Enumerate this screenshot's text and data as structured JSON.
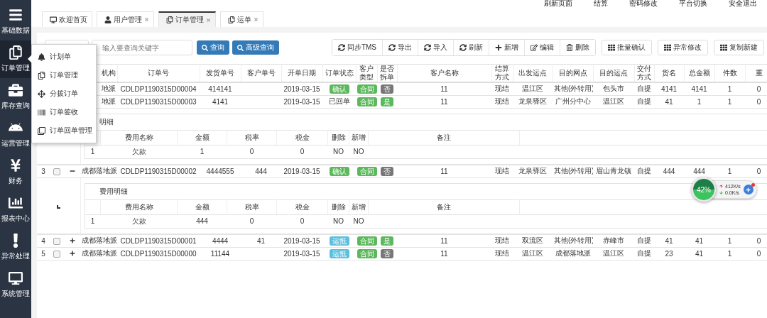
{
  "header_links": [
    "刷新页面",
    "结算",
    "密码修改",
    "平台切换",
    "安全退出"
  ],
  "sidebar": [
    {
      "label": "基础数据",
      "selected": false
    },
    {
      "label": "订单管理",
      "selected": true
    },
    {
      "label": "库存查询",
      "selected": false
    },
    {
      "label": "运营管理",
      "selected": false
    },
    {
      "label": "财务",
      "selected": false
    },
    {
      "label": "报表中心",
      "selected": false
    },
    {
      "label": "异常处理",
      "selected": false
    },
    {
      "label": "系统管理",
      "selected": false
    }
  ],
  "submenu": [
    {
      "label": "计划单"
    },
    {
      "label": "订单管理"
    },
    {
      "label": "分拨订单"
    },
    {
      "label": "订单签收"
    },
    {
      "label": "订单回单管理"
    }
  ],
  "tabs": [
    {
      "label": "欢迎首页",
      "closable": false,
      "selected": false
    },
    {
      "label": "用户管理",
      "closable": true,
      "selected": false
    },
    {
      "label": "订单管理",
      "closable": true,
      "selected": true
    },
    {
      "label": "运单",
      "closable": true,
      "selected": false
    }
  ],
  "toolbar": {
    "search": {
      "placeholder": "输入要查询关键字"
    },
    "search_buttons": [
      "查询",
      "高级查询"
    ],
    "actions": [
      "同步TMS",
      "导出",
      "导入",
      "刷新",
      "新增",
      "编辑",
      "删除"
    ],
    "extra_actions": [
      "批量确认",
      "异常修改",
      "复制新建"
    ]
  },
  "table": {
    "columns": [
      "机构",
      "订单号",
      "发货单号",
      "客户单号",
      "开单日期",
      "订单状态",
      "客户类型",
      "是否拆单",
      "客户名称",
      "结算方式",
      "出发运点",
      "目的网点",
      "目的运点",
      "交付方式",
      "货名",
      "总金额",
      "件数",
      "重"
    ],
    "rows": [
      {
        "org": "地派",
        "order_no": "CDLDP1190315D00004",
        "ship_no": "414141",
        "date": "2019-03-15",
        "status": {
          "text": "确认",
          "kind": "confirmed"
        },
        "type": "合同",
        "split": {
          "text": "否",
          "on": false
        },
        "customer": "11",
        "settle": "现结",
        "from": "温江区",
        "dest_point": "其他(外转用)",
        "dest": "包头市",
        "delivery": "自提",
        "goods": "4141",
        "total": "4141",
        "pieces": "1",
        "weight": "0"
      },
      {
        "org": "地派",
        "order_no": "CDLDP1190315D00003",
        "ship_no": "4141",
        "date": "2019-03-15",
        "status": {
          "text": "已回单",
          "kind": "plain"
        },
        "type": "合同",
        "split": {
          "text": "是",
          "on": true
        },
        "customer": "11",
        "settle": "现结",
        "from": "龙泉驿区",
        "dest_point": "广州分中心",
        "dest": "温江区",
        "delivery": "自提",
        "goods": "41",
        "total": "1",
        "pieces": "1",
        "weight": "0",
        "detail": {
          "title": "明细",
          "marker": false,
          "columns": [
            "费用名称",
            "金额",
            "税率",
            "税金",
            "删除",
            "新增",
            "备注"
          ],
          "rows": [
            {
              "index": "1",
              "cells": [
                "欠款",
                "1",
                "0",
                "0",
                "NO",
                "NO"
              ]
            }
          ]
        }
      },
      {
        "number": "3",
        "checked": false,
        "expanded": true,
        "org": "成都落地派",
        "order_no": "CDLDP1190315D00002",
        "ship_no": "4444555",
        "customer_no": "444",
        "date": "2019-03-15",
        "status": {
          "text": "确认",
          "kind": "confirmed"
        },
        "type": "合同",
        "split": {
          "text": "否",
          "on": false
        },
        "customer": "11",
        "settle": "现结",
        "from": "龙泉驿区",
        "dest_point": "其他(外转用)",
        "dest": "眉山青龙镇",
        "delivery": "自提",
        "goods": "444",
        "total": "444",
        "pieces": "1",
        "weight": "0",
        "detail": {
          "title": "费用明细",
          "marker": true,
          "columns": [
            "费用名称",
            "金额",
            "税率",
            "税金",
            "删除",
            "新增",
            "备注"
          ],
          "rows": [
            {
              "index": "1",
              "cells": [
                "欠款",
                "444",
                "0",
                "0",
                "NO",
                "NO"
              ]
            }
          ]
        }
      },
      {
        "number": "4",
        "checked": false,
        "expanded": false,
        "org": "成都落地派",
        "order_no": "CDLDP1190315D00001",
        "ship_no": "4444",
        "customer_no": "41",
        "date": "2019-03-15",
        "status": {
          "text": "运抵",
          "kind": "arrived"
        },
        "type": "合同",
        "split": {
          "text": "是",
          "on": true
        },
        "customer": "11",
        "settle": "现结",
        "from": "双流区",
        "dest_point": "其他(外转用)",
        "dest": "赤峰市",
        "delivery": "自提",
        "goods": "41",
        "total": "41",
        "pieces": "1",
        "weight": "0"
      },
      {
        "number": "5",
        "checked": false,
        "expanded": false,
        "org": "成都落地派",
        "order_no": "CDLDP1190315D00000",
        "ship_no": "11144",
        "date": "2019-03-15",
        "status": {
          "text": "运抵",
          "kind": "arrived"
        },
        "type": "合同",
        "split": {
          "text": "否",
          "on": false
        },
        "customer": "11",
        "settle": "现结",
        "from": "温江区",
        "dest_point": "成都落地派",
        "dest": "温江区",
        "delivery": "自提",
        "goods": "23",
        "total": "41",
        "pieces": "1",
        "weight": "0"
      }
    ]
  },
  "speed_widget": {
    "percent": "42%",
    "up": "412K/s",
    "down": "0.0K/s"
  }
}
